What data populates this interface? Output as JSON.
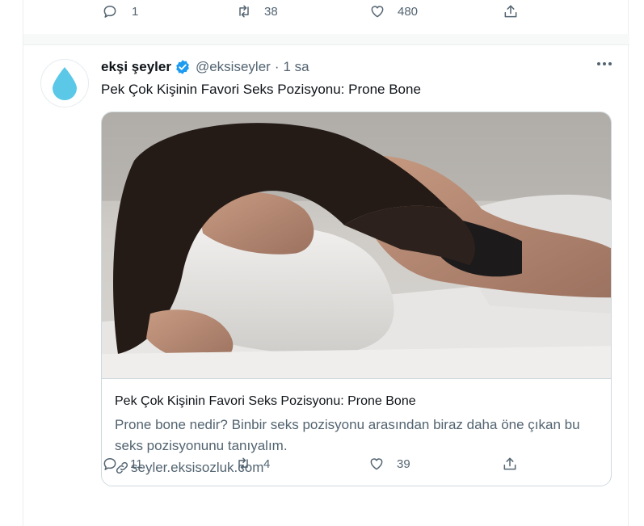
{
  "prev_tweet": {
    "actions": {
      "reply_count": "1",
      "retweet_count": "38",
      "like_count": "480"
    }
  },
  "tweet": {
    "author_name": "ekşi şeyler",
    "handle": "@eksiseyler",
    "separator": "·",
    "time": "1 sa",
    "text": "Pek Çok Kişinin Favori Seks Pozisyonu: Prone Bone",
    "verified": true,
    "avatar_icon": "water-drop-icon",
    "card": {
      "title": "Pek Çok Kişinin Favori Seks Pozisyonu: Prone Bone",
      "description": "Prone bone nedir? Binbir seks pozisyonu arasından biraz daha öne çıkan bu seks pozisyonunu tanıyalım.",
      "domain": "seyler.eksisozluk.com",
      "image_subject": "woman-sleeping-on-pillow-image"
    },
    "actions": {
      "reply_count": "11",
      "retweet_count": "4",
      "like_count": "39"
    }
  },
  "colors": {
    "text_primary": "#0f1419",
    "text_secondary": "#536471",
    "border": "#ebeef0",
    "verified_blue": "#1d9bf0",
    "avatar_drop": "#5bc8e8"
  }
}
